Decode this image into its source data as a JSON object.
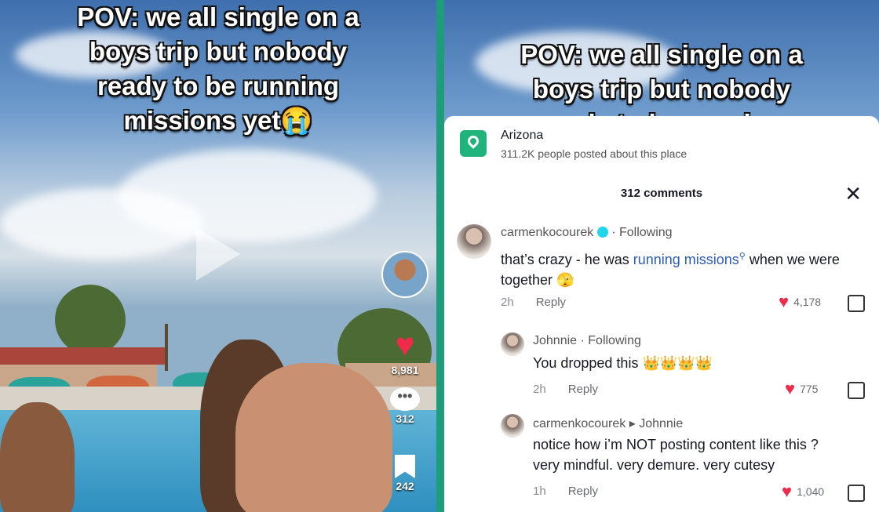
{
  "left_video": {
    "caption_lines": [
      "POV: we all single on a",
      "boys trip  but nobody",
      "ready to be running",
      "missions yet😭"
    ],
    "likes": "8,981",
    "comments": "312",
    "saves": "242"
  },
  "right_video": {
    "caption_lines": [
      "POV: we all single on a",
      "boys trip  but nobody",
      "ready to be running"
    ]
  },
  "location": {
    "name": "Arizona",
    "subtitle": "311.2K people posted about this place"
  },
  "comments_header": "312 comments",
  "comments": [
    {
      "user": "carmenkocourek",
      "following": "· Following",
      "text_before": "that’s crazy - he was ",
      "link": "running missions",
      "text_after": " when we were together 🫣",
      "age": "2h",
      "reply": "Reply",
      "likes": "4,178"
    },
    {
      "user": "Johnnie",
      "following": "· Following",
      "text": "You dropped this 👑👑👑👑",
      "age": "2h",
      "reply": "Reply",
      "likes": "775"
    },
    {
      "user": "carmenkocourek",
      "reply_to": "▸ Johnnie",
      "text_line1": "notice how i’m NOT posting content like this ?",
      "text_line2": "very mindful. very demure. very cutesy",
      "age": "1h",
      "reply": "Reply",
      "likes": "1,040"
    }
  ],
  "colors": {
    "divider": "#1f9d7a",
    "heart": "#f02a4a",
    "link": "#2b5db8",
    "location": "#21b37c"
  }
}
